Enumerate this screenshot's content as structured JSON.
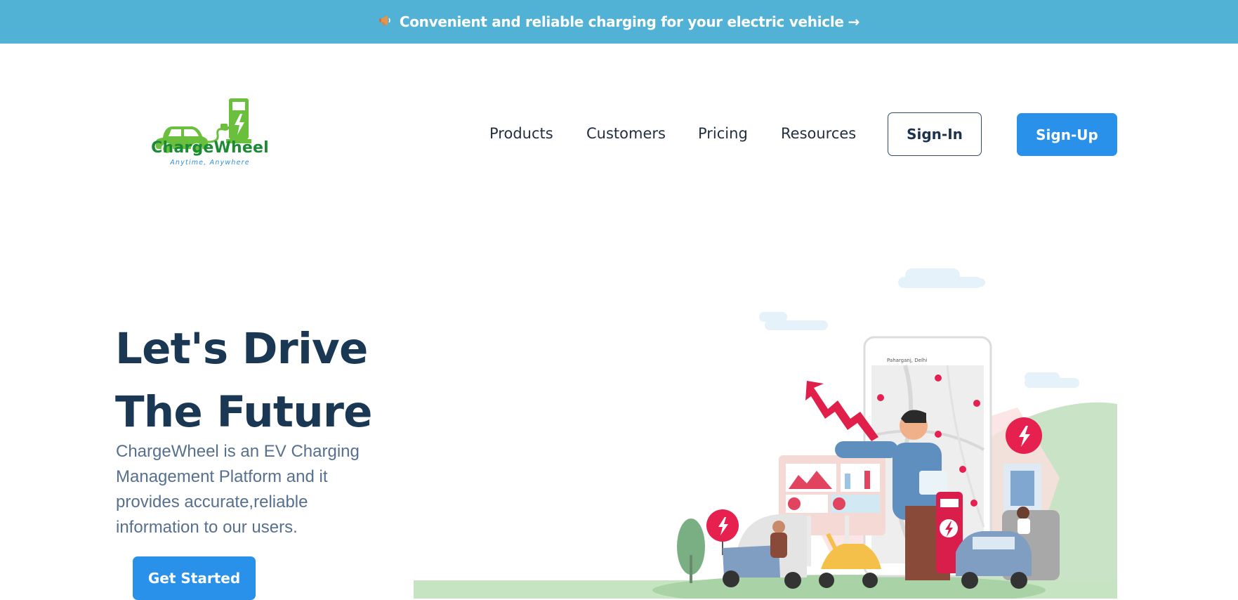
{
  "banner": {
    "icon": "megaphone-icon",
    "text": "Convenient and reliable charging for your electric vehicle",
    "arrow": "→"
  },
  "brand": {
    "name": "ChargeWheel",
    "tagline": "Anytime, Anywhere",
    "color": "#1a8a35",
    "accent": "#6abf3c"
  },
  "nav": {
    "items": [
      "Products",
      "Customers",
      "Pricing",
      "Resources"
    ],
    "signin_label": "Sign-In",
    "signup_label": "Sign-Up"
  },
  "hero": {
    "title_line1": "Let's Drive",
    "title_line2": "The Future",
    "description": "ChargeWheel is an EV Charging Management Platform and it provides accurate,reliable information to our users.",
    "cta_label": "Get Started"
  },
  "illustration": {
    "map_location": "Paharganj, Delhi"
  },
  "colors": {
    "banner": "#51b2d5",
    "primary_button": "#2991ea",
    "heading": "#1a3753",
    "body_text": "#56708e"
  }
}
